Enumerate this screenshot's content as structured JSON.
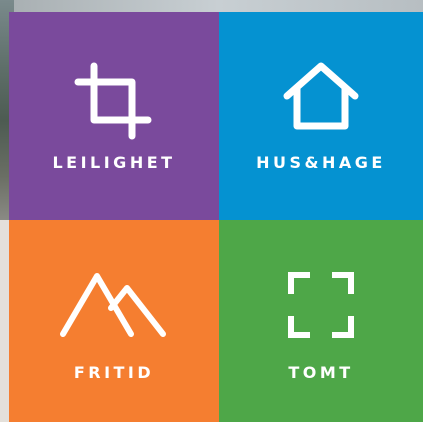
{
  "colors": {
    "purple": "#7a4a9c",
    "blue": "#0592d1",
    "orange": "#f57e30",
    "green": "#4ea748"
  },
  "tiles": [
    {
      "label": "LEILIGHET",
      "icon": "crop-icon"
    },
    {
      "label": "HUS&HAGE",
      "icon": "house-icon"
    },
    {
      "label": "FRITID",
      "icon": "mountains-icon"
    },
    {
      "label": "TOMT",
      "icon": "corners-icon"
    }
  ]
}
